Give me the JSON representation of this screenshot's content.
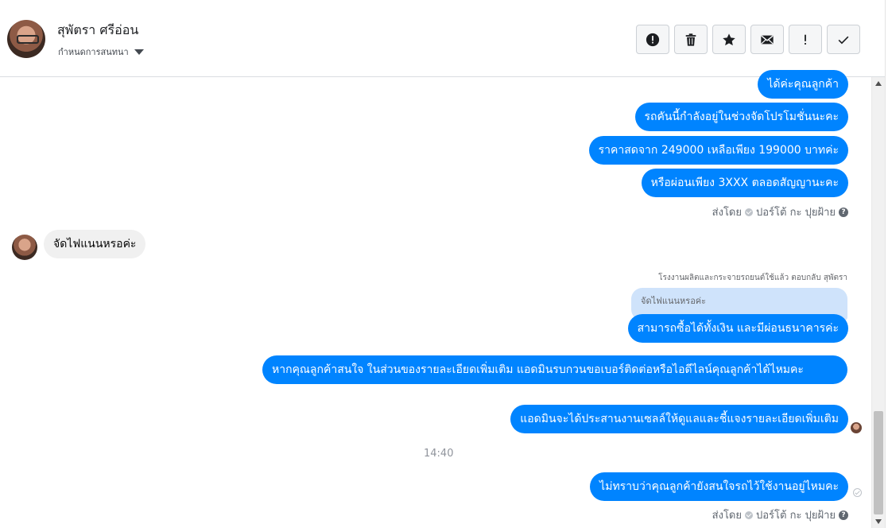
{
  "header": {
    "contact_name": "สุพัตรา ศรีอ่อน",
    "manage_label": "กำหนดการสนทนา",
    "toolbar": [
      {
        "name": "report-button",
        "icon": "alert-circle-icon",
        "glyph": "!"
      },
      {
        "name": "delete-button",
        "icon": "trash-icon"
      },
      {
        "name": "star-button",
        "icon": "star-icon"
      },
      {
        "name": "mark-unread-button",
        "icon": "envelope-icon"
      },
      {
        "name": "mark-important-button",
        "icon": "exclamation-icon",
        "glyph": "!"
      },
      {
        "name": "mark-done-button",
        "icon": "check-icon"
      }
    ]
  },
  "messages": {
    "out_1": "ได้ค่ะคุณลูกค้า",
    "out_2": "รถคันนี้กำลังอยู่ในช่วงจัดโปรโมชั่นนะคะ",
    "out_3": "ราคาสดจาก 249000 เหลือเพียง 199000 บาทค่ะ",
    "out_4": "หรือผ่อนเพียง 3XXX ตลอดสัญญานะคะ",
    "in_1": "จัดไฟแนนหรอค่ะ",
    "reply_meta": "โรงงานผลิตและกระจายรถยนต์ใช้แล้ว ตอบกลับ สุพัตรา",
    "reply_quote": "จัดไฟแนนหรอค่ะ",
    "out_5": "สามารถซื้อได้ทั้งเงิน และมีผ่อนธนาคารค่ะ",
    "out_6": "หากคุณลูกค้าสนใจ ในส่วนของรายละเอียดเพิ่มเติม แอดมินรบกวนขอเบอร์ติดต่อหรือไอดีไลน์คุณลูกค้าได้ไหมคะ",
    "out_7": "แอดมินจะได้ประสานงานเซลล์ให้ดูแลและชี้แจงรายละเอียดเพิ่มเติม",
    "timestamp": "14:40",
    "out_8": "ไม่ทราบว่าคุณลูกค้ายังสนใจรถไว้ใช้งานอยู่ไหมคะ"
  },
  "sent_by": {
    "prefix": "ส่งโดย",
    "sender": "ปอร์โต้ กะ ปุยฝ้าย",
    "help": "?"
  },
  "colors": {
    "outgoing_bubble": "#0084ff",
    "incoming_bubble": "#f0f0f0",
    "reply_quote_bg": "#cfe3fb"
  }
}
